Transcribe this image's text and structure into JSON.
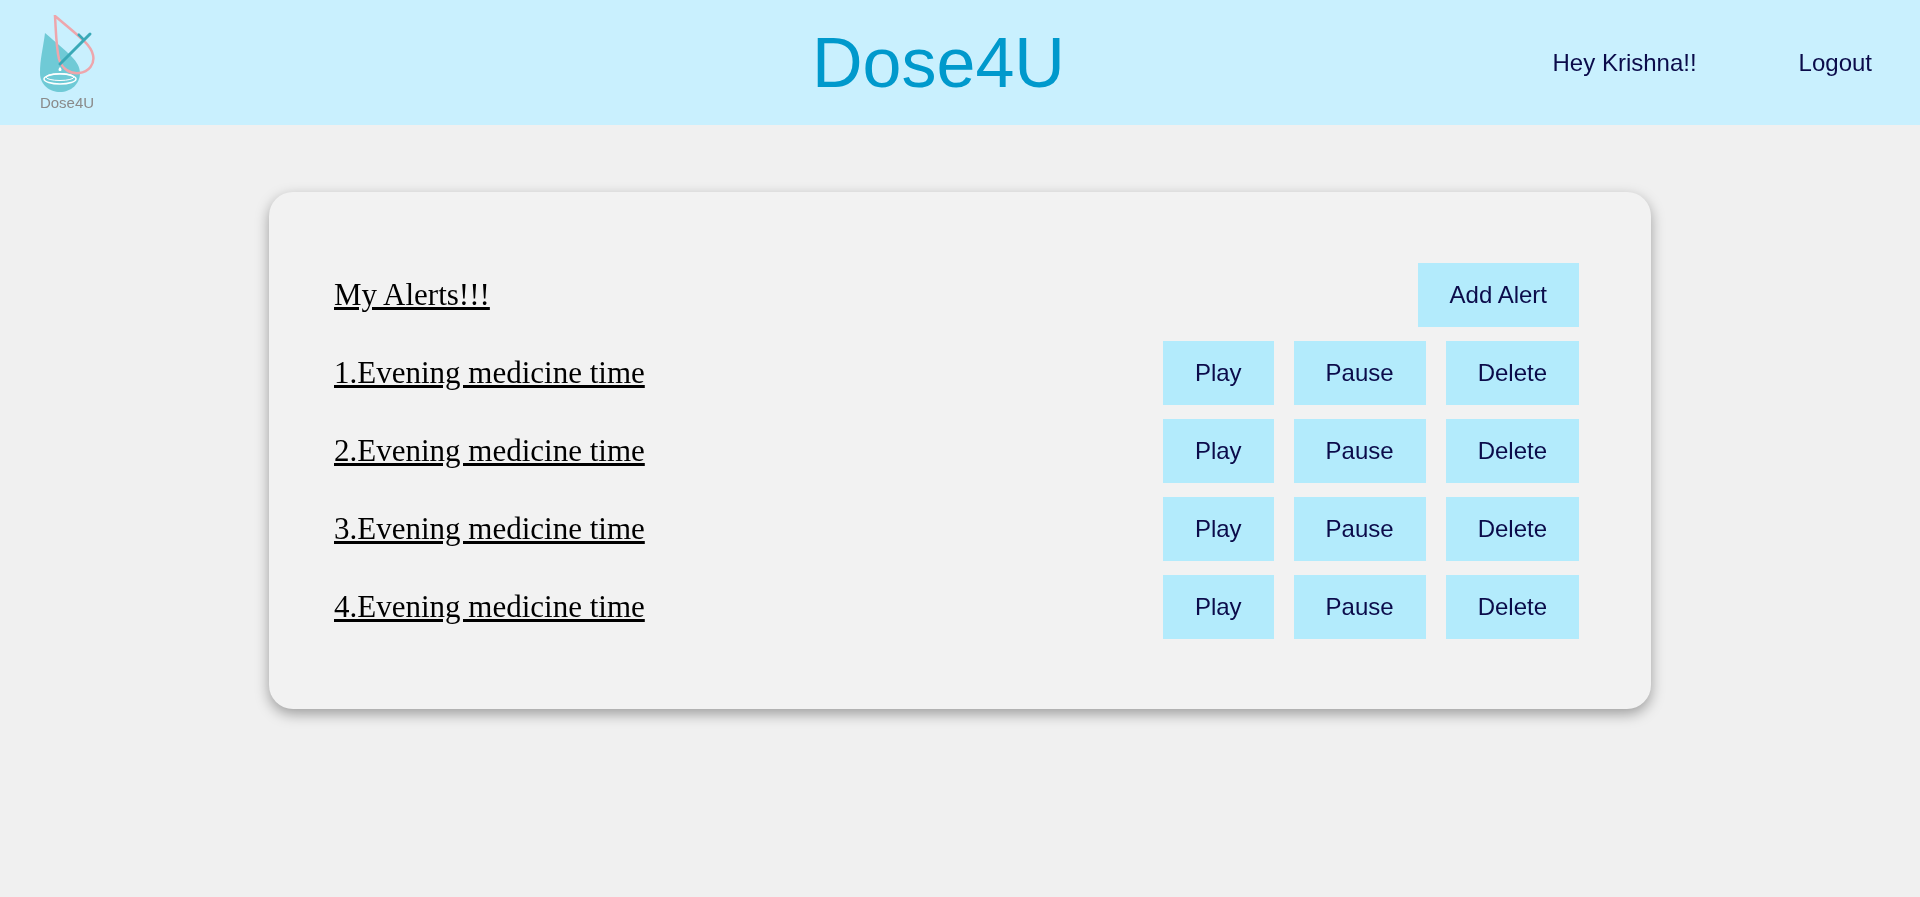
{
  "header": {
    "logo": {
      "caption": "Dose4U"
    },
    "title": "Dose4U",
    "greeting": "Hey Krishna!!",
    "logout": "Logout"
  },
  "alerts": {
    "heading": "My Alerts!!!",
    "add_button": "Add Alert",
    "items": [
      {
        "label": "1.Evening medicine time",
        "actions": [
          "Play",
          "Pause",
          "Delete"
        ]
      },
      {
        "label": "2.Evening medicine time",
        "actions": [
          "Play",
          "Pause",
          "Delete"
        ]
      },
      {
        "label": "3.Evening medicine time",
        "actions": [
          "Play",
          "Pause",
          "Delete"
        ]
      },
      {
        "label": "4.Evening medicine time",
        "actions": [
          "Play",
          "Pause",
          "Delete"
        ]
      }
    ]
  }
}
